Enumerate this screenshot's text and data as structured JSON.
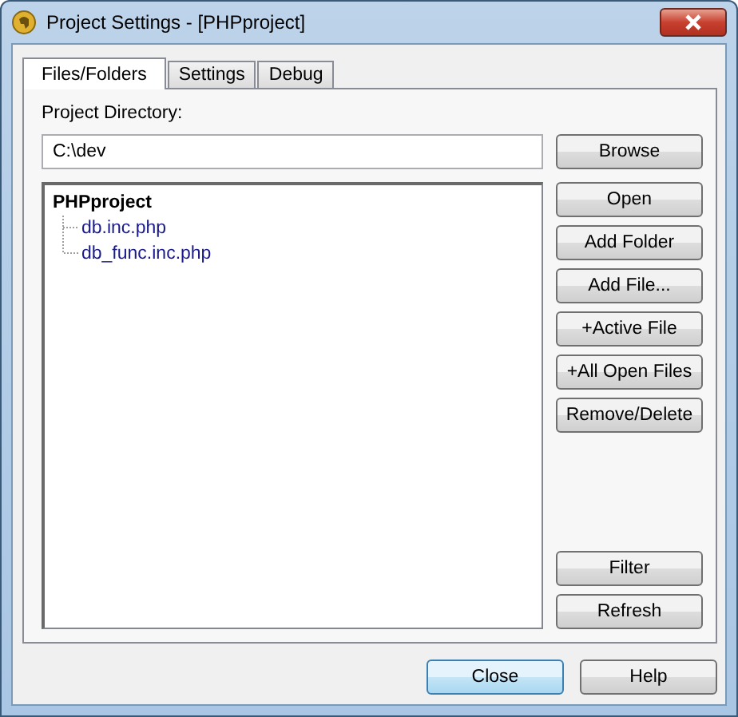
{
  "window": {
    "title": "Project Settings - [PHPproject]"
  },
  "tabs": [
    {
      "label": "Files/Folders",
      "selected": true
    },
    {
      "label": "Settings",
      "selected": false
    },
    {
      "label": "Debug",
      "selected": false
    }
  ],
  "directory": {
    "label": "Project Directory:",
    "value": "C:\\dev",
    "browse": "Browse"
  },
  "tree": {
    "label": "PHPproject",
    "children": [
      {
        "label": "db.inc.php"
      },
      {
        "label": "db_func.inc.php"
      }
    ]
  },
  "side_buttons": [
    "Open",
    "Add Folder",
    "Add File...",
    "+Active File",
    "+All Open Files",
    "Remove/Delete"
  ],
  "lower_buttons": [
    "Filter",
    "Refresh"
  ],
  "footer_buttons": [
    {
      "label": "Close",
      "default": true
    },
    {
      "label": "Help",
      "default": false
    }
  ]
}
